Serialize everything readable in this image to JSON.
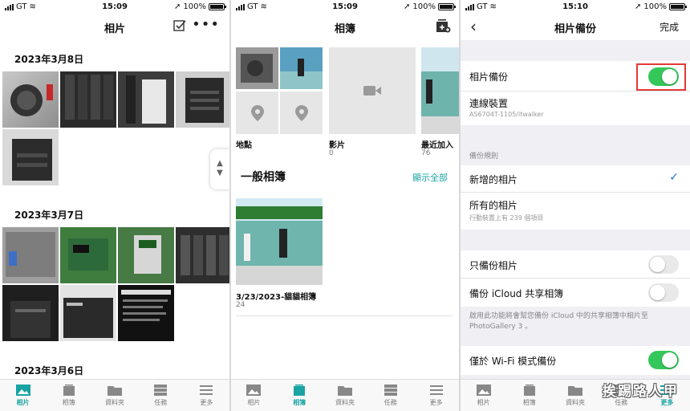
{
  "status_bars": [
    {
      "carrier": "GT",
      "time": "15:09",
      "battery": "100%"
    },
    {
      "carrier": "GT",
      "time": "15:09",
      "battery": "100%"
    },
    {
      "carrier": "GT",
      "time": "15:10",
      "battery": "100%"
    }
  ],
  "photos_screen": {
    "title": "相片",
    "select_icon": "checkbox-icon",
    "more_icon": "more-icon",
    "sections": [
      {
        "date": "2023年3月8日"
      },
      {
        "date": "2023年3月7日"
      },
      {
        "date": "2023年3月6日"
      }
    ]
  },
  "albums_screen": {
    "title": "相簿",
    "add_icon": "add-album-icon",
    "smart_albums": [
      {
        "label": "地點",
        "count": ""
      },
      {
        "label": "影片",
        "count": "0"
      },
      {
        "label": "最近加入",
        "count": "76"
      }
    ],
    "general_title": "一般相簿",
    "show_all": "顯示全部",
    "general_albums": [
      {
        "label": "3/23/2023-貓貓相簿",
        "count": "24"
      }
    ]
  },
  "backup_screen": {
    "title": "相片備份",
    "done": "完成",
    "backup_toggle": {
      "label": "相片備份",
      "on": true
    },
    "device": {
      "label": "連線裝置",
      "value": "AS6704T-1105/itwalker"
    },
    "rules_header": "備份規則",
    "rules": [
      {
        "label": "新增的相片",
        "sub": "",
        "checked": true
      },
      {
        "label": "所有的相片",
        "sub": "行動裝置上有 239 個項目",
        "checked": false
      }
    ],
    "options": [
      {
        "label": "只備份相片",
        "on": false
      },
      {
        "label": "備份 iCloud 共享相簿",
        "on": false
      }
    ],
    "icloud_note_1": "啟用此功能將會幫您備份 iCloud 中的共享相簿中相片至",
    "icloud_note_2": "PhotoGallery 3 。",
    "wifi_only": {
      "label": "僅於 Wi-Fi 模式備份",
      "on": true
    }
  },
  "tabs": [
    {
      "label": "相片",
      "icon": "photo-icon"
    },
    {
      "label": "相簿",
      "icon": "album-icon"
    },
    {
      "label": "資料夾",
      "icon": "folder-icon"
    },
    {
      "label": "任務",
      "icon": "task-icon"
    },
    {
      "label": "更多",
      "icon": "more-menu-icon"
    }
  ],
  "active_tabs": [
    "相片",
    "相簿",
    "更多"
  ],
  "watermark": "挨踢路人甲",
  "colors": {
    "accent": "#1aa3a3",
    "toggle_on": "#34c759",
    "highlight": "#e53935",
    "check": "#1a73e8"
  }
}
